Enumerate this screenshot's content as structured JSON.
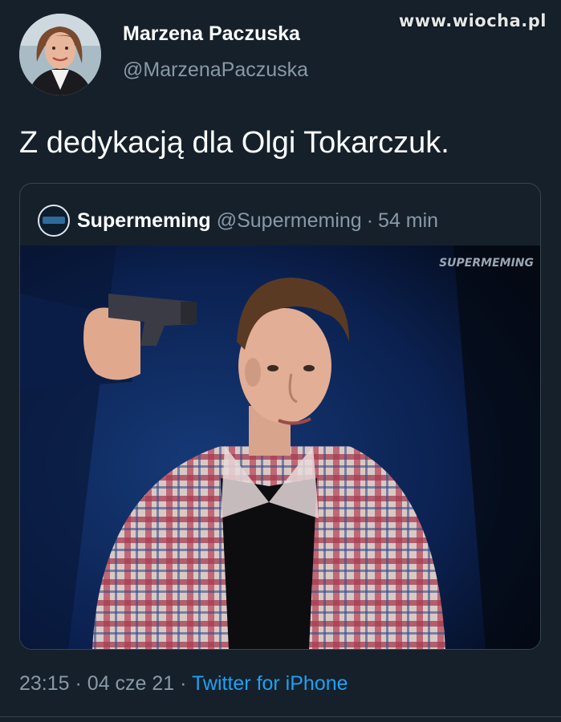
{
  "watermark": "www.wiocha.pl",
  "tweet": {
    "author_name": "Marzena Paczuska",
    "author_handle": "@MarzenaPaczuska",
    "text": "Z dedykacją dla Olgi Tokarczuk.",
    "time": "23:15",
    "date": "04 cze 21",
    "source": "Twitter for iPhone",
    "separator": "·"
  },
  "quoted_tweet": {
    "author_name": "Supermeming",
    "author_handle": "@Supermeming",
    "separator": "·",
    "time_ago": "54 min",
    "media_watermark": "SUPERMEMING"
  },
  "colors": {
    "background": "#15202b",
    "secondary_text": "#8899a6",
    "link": "#1da1f2",
    "border": "#38444d"
  }
}
